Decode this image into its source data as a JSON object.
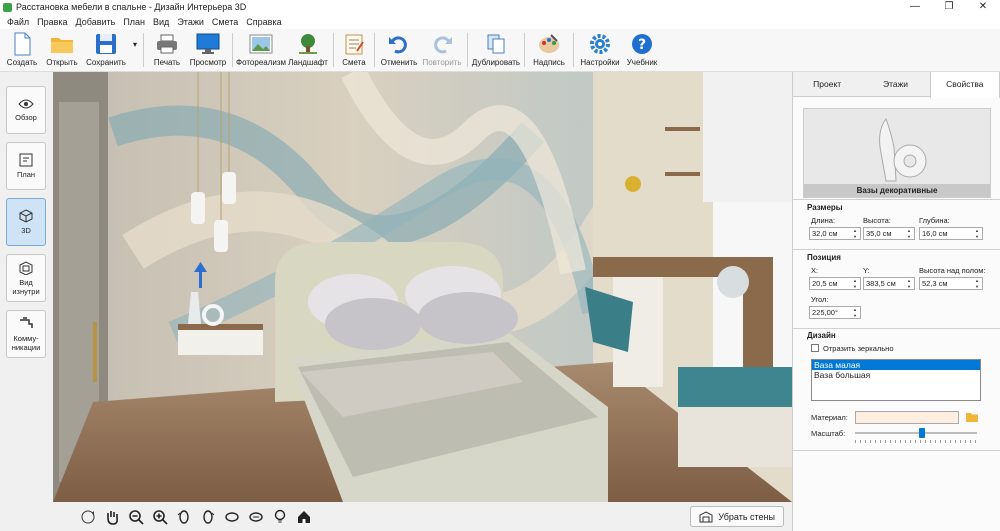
{
  "window": {
    "title": "Расстановка мебели в спальне - Дизайн Интерьера 3D",
    "minimize": "—",
    "maximize": "❐",
    "close": "✕"
  },
  "menu": [
    "Файл",
    "Правка",
    "Добавить",
    "План",
    "Вид",
    "Этажи",
    "Смета",
    "Справка"
  ],
  "toolbar": {
    "create": "Создать",
    "open": "Открыть",
    "save": "Сохранить",
    "save_arrow": "▾",
    "print": "Печать",
    "preview": "Просмотр",
    "photo": "Фотореализм",
    "landscape": "Ландшафт",
    "estimate": "Смета",
    "undo": "Отменить",
    "redo": "Повторить",
    "duplicate": "Дублировать",
    "caption": "Надпись",
    "settings": "Настройки",
    "tutorial": "Учебник"
  },
  "leftbar": {
    "overview": "Обзор",
    "plan": "План",
    "view3d": "3D",
    "inside_view": "Вид изнутри",
    "communications": "Комму-никации"
  },
  "bottombar": {
    "remove_walls": "Убрать стены"
  },
  "panel": {
    "tabs": [
      "Проект",
      "Этажи",
      "Свойства"
    ],
    "preview_caption": "Вазы декоративные",
    "sizes": {
      "title": "Размеры",
      "length_label": "Длина:",
      "length": "32,0 см",
      "height_label": "Высота:",
      "height": "35,0 см",
      "depth_label": "Глубина:",
      "depth": "16,0 см"
    },
    "position": {
      "title": "Позиция",
      "x_label": "X:",
      "x": "20,5 см",
      "y_label": "Y:",
      "y": "383,5 см",
      "floor_label": "Высота над полом:",
      "floor": "52,3 см",
      "angle_label": "Угол:",
      "angle": "225,00°"
    },
    "design": {
      "title": "Дизайн",
      "mirror_label": "Отразить зеркально",
      "items": [
        "Ваза малая",
        "Ваза большая"
      ],
      "material_label": "Материал:",
      "scale_label": "Масштаб:",
      "scale_level": 0.55
    }
  },
  "colors": {
    "accent": "#0078d7",
    "active_tab": "#cfe3f7",
    "material": "#fdeee0"
  }
}
